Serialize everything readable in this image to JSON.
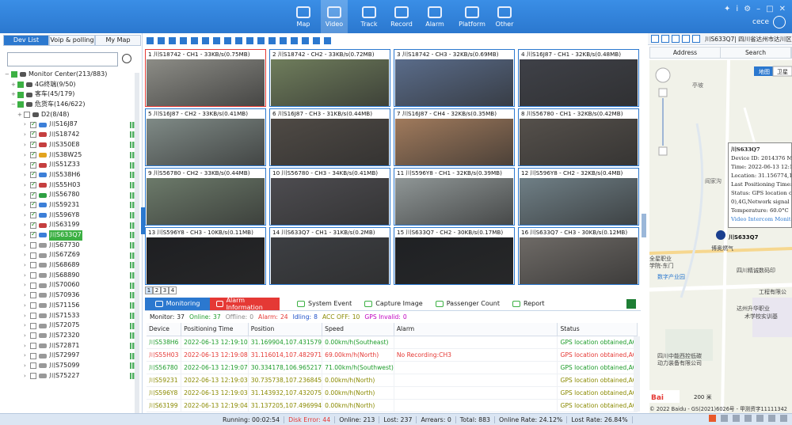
{
  "nav": {
    "items": [
      {
        "label": "Map"
      },
      {
        "label": "Video"
      },
      {
        "label": "Track"
      },
      {
        "label": "Record"
      },
      {
        "label": "Alarm"
      },
      {
        "label": "Platform"
      },
      {
        "label": "Other"
      }
    ],
    "active": "Video"
  },
  "user": {
    "name": "cece"
  },
  "left": {
    "tabs": [
      "Dev List",
      "Voip & polling",
      "My Map"
    ],
    "search": {
      "value": "",
      "placeholder": ""
    },
    "tree": [
      {
        "label": "Monitor Center(213/883)",
        "level": 0,
        "exp": "−"
      },
      {
        "label": "4G终端(9/50)",
        "level": 1,
        "exp": "+"
      },
      {
        "label": "客车(45/179)",
        "level": 1,
        "exp": "+"
      },
      {
        "label": "危货车(146/622)",
        "level": 1,
        "exp": "−"
      },
      {
        "label": "D2(8/48)",
        "level": 2,
        "exp": "+"
      },
      {
        "label": "川S16J87",
        "level": 3,
        "on": true,
        "veh": "#3c7fd8"
      },
      {
        "label": "川S18742",
        "level": 3,
        "on": true,
        "veh": "#c53f3f"
      },
      {
        "label": "川S350E8",
        "level": 3,
        "on": true,
        "veh": "#c53f3f"
      },
      {
        "label": "川S38W25",
        "level": 3,
        "on": true,
        "veh": "#e2a31f"
      },
      {
        "label": "川S51Z33",
        "level": 3,
        "on": true,
        "veh": "#c53f3f"
      },
      {
        "label": "川S538H6",
        "level": 3,
        "on": true,
        "veh": "#3c7fd8"
      },
      {
        "label": "川S55H03",
        "level": 3,
        "on": true,
        "veh": "#c53f3f"
      },
      {
        "label": "川S56780",
        "level": 3,
        "on": true,
        "veh": "#2ea043"
      },
      {
        "label": "川S59231",
        "level": 3,
        "on": true,
        "veh": "#3c7fd8"
      },
      {
        "label": "川S596Y8",
        "level": 3,
        "on": true,
        "veh": "#3c7fd8"
      },
      {
        "label": "川S63199",
        "level": 3,
        "on": true,
        "veh": "#c53f3f"
      },
      {
        "label": "川S633Q7",
        "level": 3,
        "on": true,
        "veh": "#3c7fd8",
        "hl": true
      },
      {
        "label": "川S67730",
        "level": 3,
        "on": false,
        "veh": "#999"
      },
      {
        "label": "川S67Z69",
        "level": 3,
        "on": false,
        "veh": "#999"
      },
      {
        "label": "川S68689",
        "level": 3,
        "on": false,
        "veh": "#999"
      },
      {
        "label": "川S68890",
        "level": 3,
        "on": false,
        "veh": "#999"
      },
      {
        "label": "川S70060",
        "level": 3,
        "on": false,
        "veh": "#999"
      },
      {
        "label": "川S70936",
        "level": 3,
        "on": false,
        "veh": "#999"
      },
      {
        "label": "川S71156",
        "level": 3,
        "on": false,
        "veh": "#999"
      },
      {
        "label": "川S71533",
        "level": 3,
        "on": false,
        "veh": "#999"
      },
      {
        "label": "川S72075",
        "level": 3,
        "on": false,
        "veh": "#999"
      },
      {
        "label": "川S72320",
        "level": 3,
        "on": false,
        "veh": "#999"
      },
      {
        "label": "川S72871",
        "level": 3,
        "on": false,
        "veh": "#999"
      },
      {
        "label": "川S72997",
        "level": 3,
        "on": false,
        "veh": "#999"
      },
      {
        "label": "川S75099",
        "level": 3,
        "on": false,
        "veh": "#999"
      },
      {
        "label": "川S75227",
        "level": 3,
        "on": false,
        "veh": "#999"
      }
    ]
  },
  "videos": [
    {
      "title": "1  川S18742 - CH1 - 33KB/s(0.75MB)",
      "sel": true,
      "tone": "#8c8c86"
    },
    {
      "title": "2  川S18742 - CH2 - 33KB/s(0.72MB)",
      "tone": "#6f7d5c"
    },
    {
      "title": "3  川S18742 - CH3 - 32KB/s(0.69MB)",
      "tone": "#5a6c8a"
    },
    {
      "title": "4  川S16J87 - CH1 - 32KB/s(0.48MB)",
      "tone": "#3f4148"
    },
    {
      "title": "5  川S16J87 - CH2 - 33KB/s(0.41MB)",
      "tone": "#7f8a86"
    },
    {
      "title": "6  川S16J87 - CH3 - 31KB/s(0.44MB)",
      "tone": "#4f4a45"
    },
    {
      "title": "7  川S16J87 - CH4 - 32KB/s(0.35MB)",
      "tone": "#a07a5c"
    },
    {
      "title": "8  川S56780 - CH1 - 32KB/s(0.42MB)",
      "tone": "#55504b"
    },
    {
      "title": "9  川S56780 - CH2 - 33KB/s(0.44MB)",
      "tone": "#6c7a6a"
    },
    {
      "title": "10  川S56780 - CH3 - 34KB/s(0.41MB)",
      "tone": "#4d4c50"
    },
    {
      "title": "11  川S596Y8 - CH1 - 32KB/s(0.39MB)",
      "tone": "#8f9696"
    },
    {
      "title": "12  川S596Y8 - CH2 - 32KB/s(0.4MB)",
      "tone": "#6f7f86"
    },
    {
      "title": "13  川S596Y8 - CH3 - 10KB/s(0.11MB)",
      "tone": "#1e1f22"
    },
    {
      "title": "14  川S633Q7 - CH1 - 31KB/s(0.2MB)",
      "tone": "#3d3f43"
    },
    {
      "title": "15  川S633Q7 - CH2 - 30KB/s(0.17MB)",
      "tone": "#1f2124"
    },
    {
      "title": "16  川S633Q7 - CH3 - 30KB/s(0.12MB)",
      "tone": "#6e6a66"
    }
  ],
  "pages": [
    "1",
    "2",
    "3",
    "4"
  ],
  "bottom": {
    "tabs": [
      "Monitoring",
      "Alarm Information",
      "System Event",
      "Capture Image",
      "Passenger Count",
      "Report"
    ],
    "stats": [
      {
        "label": "Monitor:",
        "value": "37",
        "color": "#222"
      },
      {
        "label": "Online:",
        "value": "37",
        "color": "#1d9c2a"
      },
      {
        "label": "Offline:",
        "value": "0",
        "color": "#888"
      },
      {
        "label": "Alarm:",
        "value": "24",
        "color": "#e53935"
      },
      {
        "label": "Idling:",
        "value": "8",
        "color": "#1e50c8"
      },
      {
        "label": "ACC OFF:",
        "value": "10",
        "color": "#8a8a00"
      },
      {
        "label": "GPS Invalid:",
        "value": "0",
        "color": "#c000c0"
      }
    ],
    "headers": [
      "Device",
      "Positioning Time",
      "Position",
      "Speed",
      "Alarm",
      "Status"
    ],
    "rows": [
      {
        "c": "g",
        "cells": [
          "川S538H6",
          "2022-06-13 12:19:10",
          "31.169904,107.431579",
          "0.00km/h(Southeast)",
          "",
          "GPS location obtained,AC"
        ]
      },
      {
        "c": "r",
        "cells": [
          "川S55H03",
          "2022-06-13 12:19:08",
          "31.116014,107.482971",
          "69.00km/h(North)",
          "No Recording:CH3",
          "GPS location obtained,AC"
        ]
      },
      {
        "c": "g",
        "cells": [
          "川S56780",
          "2022-06-13 12:19:07",
          "30.334178,106.965217",
          "71.00km/h(Southwest)",
          "",
          "GPS location obtained,AC"
        ]
      },
      {
        "c": "o",
        "cells": [
          "川S59231",
          "2022-06-13 12:19:03",
          "30.735738,107.236845",
          "0.00km/h(North)",
          "",
          "GPS location obtained,AC"
        ]
      },
      {
        "c": "o",
        "cells": [
          "川S596Y8",
          "2022-06-13 12:19:03",
          "31.143932,107.432075",
          "0.00km/h(North)",
          "",
          "GPS location obtained,AC"
        ]
      },
      {
        "c": "o",
        "cells": [
          "川S63199",
          "2022-06-13 12:19:04",
          "31.137205,107.496994",
          "0.00km/h(North)",
          "",
          "GPS location obtained,AC"
        ]
      }
    ]
  },
  "map": {
    "title": "川S633Q7| 四川省达州市达川区",
    "headers": [
      "Address",
      "Search"
    ],
    "maptype": [
      "地图",
      "卫星"
    ],
    "labels": [
      "亭坡",
      "阎家沟",
      "全星职业",
      "学院-东门",
      "数字产业园",
      "四川精诚数码印",
      "工程有限公",
      "达州升华职业",
      "术学校实训基",
      "四川中能西控低碳",
      "动力装备有限公司",
      "博奥燃气"
    ],
    "popup": {
      "title": "川S633Q7",
      "lines": [
        "Device ID: 2014376 Mil",
        "Time: 2022-06-13 12:19",
        "Location: 31.156774,107",
        "Last Positioning Time: 1",
        "Status: GPS location obtai",
        "0),4G,Network signal no",
        "Temperature: 60.0°C"
      ],
      "actions": [
        "Video",
        "Intercom",
        "Monitor"
      ]
    },
    "marker": "川S633Q7",
    "scale": "200 米",
    "copyright": "© 2022 Baidu - GS(2021)6026号 - 甲测资字11111342"
  },
  "status": {
    "running": "Running: 00:02:54",
    "diskerror": "Disk Error: 44",
    "online": "Online: 213",
    "lost": "Lost: 237",
    "arrears": "Arrears: 0",
    "total": "Total: 883",
    "onlinerate": "Online Rate: 24.12%",
    "lostrate": "Lost Rate: 26.84%"
  }
}
